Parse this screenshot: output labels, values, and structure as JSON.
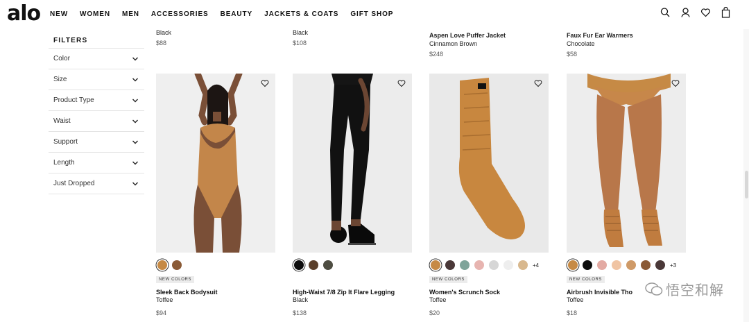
{
  "header": {
    "logo": "alo",
    "nav": [
      "NEW",
      "WOMEN",
      "MEN",
      "ACCESSORIES",
      "BEAUTY",
      "JACKETS & COATS",
      "GIFT SHOP"
    ],
    "icons": [
      "search-icon",
      "account-icon",
      "wishlist-icon",
      "bag-icon"
    ]
  },
  "sidebar": {
    "title": "FILTERS",
    "filters": [
      "Color",
      "Size",
      "Product Type",
      "Waist",
      "Support",
      "Length",
      "Just Dropped"
    ]
  },
  "top_row": [
    {
      "name": "",
      "color": "Black",
      "price": "$88"
    },
    {
      "name": "",
      "color": "Black",
      "price": "$108"
    },
    {
      "name": "Aspen Love Puffer Jacket",
      "color": "Cinnamon Brown",
      "price": "$248"
    },
    {
      "name": "Faux Fur Ear Warmers",
      "color": "Chocolate",
      "price": "$58"
    }
  ],
  "products": [
    {
      "name": "Sleek Back Bodysuit",
      "color": "Toffee",
      "price": "$94",
      "badge": "NEW COLORS",
      "more": "",
      "swatches": [
        "#c68a45",
        "#8a5a36"
      ]
    },
    {
      "name": "High-Waist 7/8 Zip It Flare Legging",
      "color": "Black",
      "price": "$138",
      "badge": "",
      "more": "",
      "swatches": [
        "#0d0d0d",
        "#5a3f2b",
        "#4e4d42"
      ]
    },
    {
      "name": "Women's Scrunch Sock",
      "color": "Toffee",
      "price": "$20",
      "badge": "NEW COLORS",
      "more": "+4",
      "swatches": [
        "#c68a45",
        "#4a3838",
        "#7fa49a",
        "#e7b4b0",
        "#d6d6d6",
        "#eeeeee",
        "#d8b88e"
      ]
    },
    {
      "name": "Airbrush Invisible Tho",
      "color": "Toffee",
      "price": "$18",
      "badge": "NEW COLORS",
      "more": "+3",
      "swatches": [
        "#c68a45",
        "#0d0d0d",
        "#e3aaa3",
        "#f0c4a3",
        "#cf9a67",
        "#8a5a36",
        "#4a3838"
      ]
    }
  ],
  "watermark": "悟空和解"
}
